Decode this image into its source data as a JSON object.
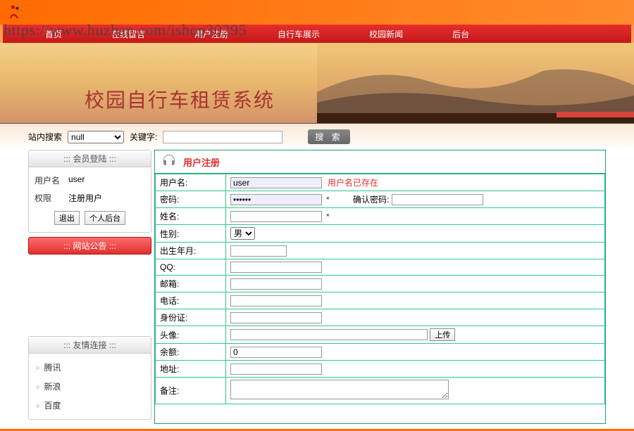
{
  "watermark": "https://www.huzhan.com/ishop30295",
  "banner": {
    "title": "校园自行车租赁系统"
  },
  "nav": [
    "首页",
    "在线留言",
    "用户注册",
    "自行车展示",
    "校园新闻",
    "后台"
  ],
  "search": {
    "label": "站内搜索",
    "select_value": "null",
    "kw_label": "关键字:",
    "kw_value": "",
    "btn": "搜 索"
  },
  "sidebar": {
    "login": {
      "head": "::: 会员登陆 :::",
      "user_label": "用户名",
      "user_value": "user",
      "role_label": "权限",
      "role_value": "注册用户",
      "btn_logout": "退出",
      "btn_center": "个人后台"
    },
    "notice_head": "::: 网站公告 :::",
    "links": {
      "head": "::: 友情连接 :::",
      "items": [
        "腾讯",
        "新浪",
        "百度"
      ]
    }
  },
  "reg": {
    "title": "用户注册",
    "username": {
      "label": "用户名:",
      "value": "user",
      "err": "用户名已存在"
    },
    "password": {
      "label": "密码:",
      "value": "••••••",
      "star": "*",
      "confirm_label": "确认密码:",
      "confirm_value": ""
    },
    "name": {
      "label": "姓名:",
      "value": "",
      "star": "*"
    },
    "gender": {
      "label": "性别:",
      "value": "男"
    },
    "birth": {
      "label": "出生年月:",
      "value": ""
    },
    "qq": {
      "label": "QQ:",
      "value": ""
    },
    "email": {
      "label": "邮箱:",
      "value": ""
    },
    "phone": {
      "label": "电话:",
      "value": ""
    },
    "idcard": {
      "label": "身份证:",
      "value": ""
    },
    "avatar": {
      "label": "头像:",
      "value": "",
      "btn": "上传"
    },
    "balance": {
      "label": "余额:",
      "value": "0"
    },
    "address": {
      "label": "地址:",
      "value": ""
    },
    "remark": {
      "label": "备注:",
      "value": ""
    }
  }
}
